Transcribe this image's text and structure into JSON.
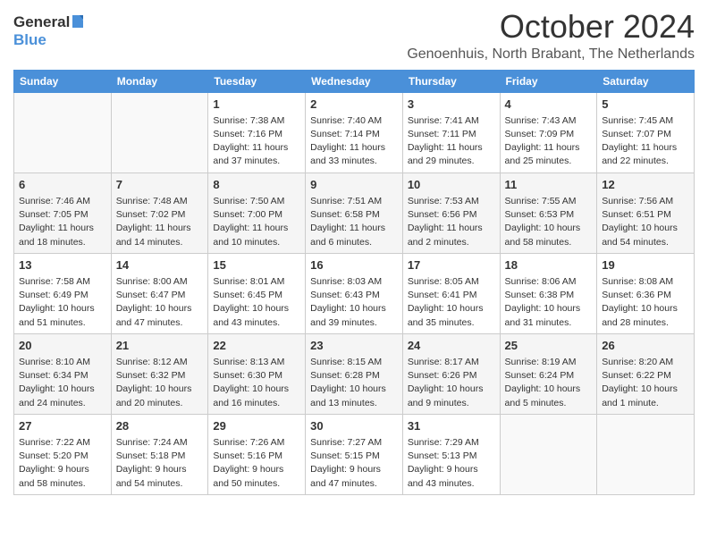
{
  "logo": {
    "general": "General",
    "blue": "Blue"
  },
  "title": "October 2024",
  "subtitle": "Genoenhuis, North Brabant, The Netherlands",
  "days_of_week": [
    "Sunday",
    "Monday",
    "Tuesday",
    "Wednesday",
    "Thursday",
    "Friday",
    "Saturday"
  ],
  "weeks": [
    [
      {
        "day": "",
        "sunrise": "",
        "sunset": "",
        "daylight": ""
      },
      {
        "day": "",
        "sunrise": "",
        "sunset": "",
        "daylight": ""
      },
      {
        "day": "1",
        "sunrise": "Sunrise: 7:38 AM",
        "sunset": "Sunset: 7:16 PM",
        "daylight": "Daylight: 11 hours and 37 minutes."
      },
      {
        "day": "2",
        "sunrise": "Sunrise: 7:40 AM",
        "sunset": "Sunset: 7:14 PM",
        "daylight": "Daylight: 11 hours and 33 minutes."
      },
      {
        "day": "3",
        "sunrise": "Sunrise: 7:41 AM",
        "sunset": "Sunset: 7:11 PM",
        "daylight": "Daylight: 11 hours and 29 minutes."
      },
      {
        "day": "4",
        "sunrise": "Sunrise: 7:43 AM",
        "sunset": "Sunset: 7:09 PM",
        "daylight": "Daylight: 11 hours and 25 minutes."
      },
      {
        "day": "5",
        "sunrise": "Sunrise: 7:45 AM",
        "sunset": "Sunset: 7:07 PM",
        "daylight": "Daylight: 11 hours and 22 minutes."
      }
    ],
    [
      {
        "day": "6",
        "sunrise": "Sunrise: 7:46 AM",
        "sunset": "Sunset: 7:05 PM",
        "daylight": "Daylight: 11 hours and 18 minutes."
      },
      {
        "day": "7",
        "sunrise": "Sunrise: 7:48 AM",
        "sunset": "Sunset: 7:02 PM",
        "daylight": "Daylight: 11 hours and 14 minutes."
      },
      {
        "day": "8",
        "sunrise": "Sunrise: 7:50 AM",
        "sunset": "Sunset: 7:00 PM",
        "daylight": "Daylight: 11 hours and 10 minutes."
      },
      {
        "day": "9",
        "sunrise": "Sunrise: 7:51 AM",
        "sunset": "Sunset: 6:58 PM",
        "daylight": "Daylight: 11 hours and 6 minutes."
      },
      {
        "day": "10",
        "sunrise": "Sunrise: 7:53 AM",
        "sunset": "Sunset: 6:56 PM",
        "daylight": "Daylight: 11 hours and 2 minutes."
      },
      {
        "day": "11",
        "sunrise": "Sunrise: 7:55 AM",
        "sunset": "Sunset: 6:53 PM",
        "daylight": "Daylight: 10 hours and 58 minutes."
      },
      {
        "day": "12",
        "sunrise": "Sunrise: 7:56 AM",
        "sunset": "Sunset: 6:51 PM",
        "daylight": "Daylight: 10 hours and 54 minutes."
      }
    ],
    [
      {
        "day": "13",
        "sunrise": "Sunrise: 7:58 AM",
        "sunset": "Sunset: 6:49 PM",
        "daylight": "Daylight: 10 hours and 51 minutes."
      },
      {
        "day": "14",
        "sunrise": "Sunrise: 8:00 AM",
        "sunset": "Sunset: 6:47 PM",
        "daylight": "Daylight: 10 hours and 47 minutes."
      },
      {
        "day": "15",
        "sunrise": "Sunrise: 8:01 AM",
        "sunset": "Sunset: 6:45 PM",
        "daylight": "Daylight: 10 hours and 43 minutes."
      },
      {
        "day": "16",
        "sunrise": "Sunrise: 8:03 AM",
        "sunset": "Sunset: 6:43 PM",
        "daylight": "Daylight: 10 hours and 39 minutes."
      },
      {
        "day": "17",
        "sunrise": "Sunrise: 8:05 AM",
        "sunset": "Sunset: 6:41 PM",
        "daylight": "Daylight: 10 hours and 35 minutes."
      },
      {
        "day": "18",
        "sunrise": "Sunrise: 8:06 AM",
        "sunset": "Sunset: 6:38 PM",
        "daylight": "Daylight: 10 hours and 31 minutes."
      },
      {
        "day": "19",
        "sunrise": "Sunrise: 8:08 AM",
        "sunset": "Sunset: 6:36 PM",
        "daylight": "Daylight: 10 hours and 28 minutes."
      }
    ],
    [
      {
        "day": "20",
        "sunrise": "Sunrise: 8:10 AM",
        "sunset": "Sunset: 6:34 PM",
        "daylight": "Daylight: 10 hours and 24 minutes."
      },
      {
        "day": "21",
        "sunrise": "Sunrise: 8:12 AM",
        "sunset": "Sunset: 6:32 PM",
        "daylight": "Daylight: 10 hours and 20 minutes."
      },
      {
        "day": "22",
        "sunrise": "Sunrise: 8:13 AM",
        "sunset": "Sunset: 6:30 PM",
        "daylight": "Daylight: 10 hours and 16 minutes."
      },
      {
        "day": "23",
        "sunrise": "Sunrise: 8:15 AM",
        "sunset": "Sunset: 6:28 PM",
        "daylight": "Daylight: 10 hours and 13 minutes."
      },
      {
        "day": "24",
        "sunrise": "Sunrise: 8:17 AM",
        "sunset": "Sunset: 6:26 PM",
        "daylight": "Daylight: 10 hours and 9 minutes."
      },
      {
        "day": "25",
        "sunrise": "Sunrise: 8:19 AM",
        "sunset": "Sunset: 6:24 PM",
        "daylight": "Daylight: 10 hours and 5 minutes."
      },
      {
        "day": "26",
        "sunrise": "Sunrise: 8:20 AM",
        "sunset": "Sunset: 6:22 PM",
        "daylight": "Daylight: 10 hours and 1 minute."
      }
    ],
    [
      {
        "day": "27",
        "sunrise": "Sunrise: 7:22 AM",
        "sunset": "Sunset: 5:20 PM",
        "daylight": "Daylight: 9 hours and 58 minutes."
      },
      {
        "day": "28",
        "sunrise": "Sunrise: 7:24 AM",
        "sunset": "Sunset: 5:18 PM",
        "daylight": "Daylight: 9 hours and 54 minutes."
      },
      {
        "day": "29",
        "sunrise": "Sunrise: 7:26 AM",
        "sunset": "Sunset: 5:16 PM",
        "daylight": "Daylight: 9 hours and 50 minutes."
      },
      {
        "day": "30",
        "sunrise": "Sunrise: 7:27 AM",
        "sunset": "Sunset: 5:15 PM",
        "daylight": "Daylight: 9 hours and 47 minutes."
      },
      {
        "day": "31",
        "sunrise": "Sunrise: 7:29 AM",
        "sunset": "Sunset: 5:13 PM",
        "daylight": "Daylight: 9 hours and 43 minutes."
      },
      {
        "day": "",
        "sunrise": "",
        "sunset": "",
        "daylight": ""
      },
      {
        "day": "",
        "sunrise": "",
        "sunset": "",
        "daylight": ""
      }
    ]
  ]
}
